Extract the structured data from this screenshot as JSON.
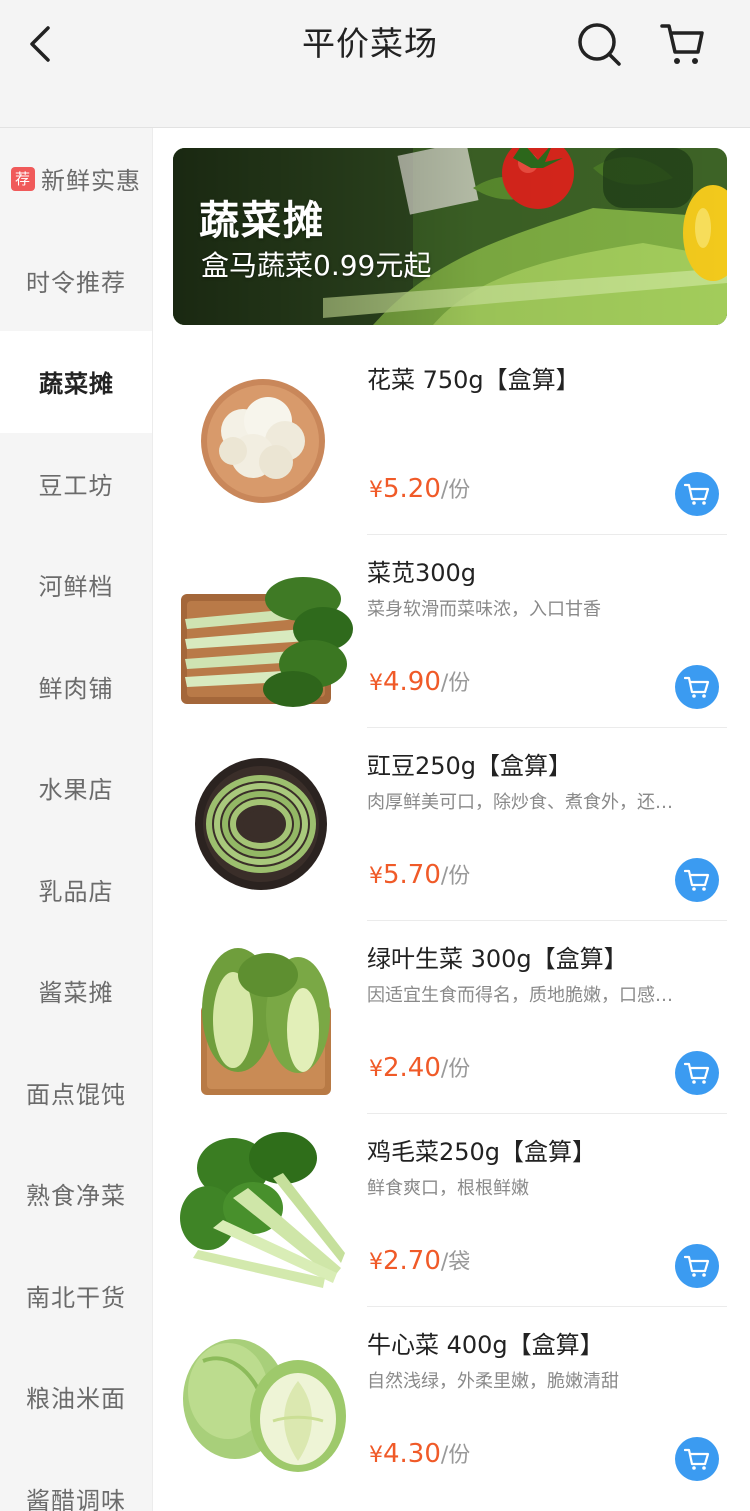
{
  "header": {
    "title": "平价菜场",
    "back_icon": "chevron-left-icon",
    "search_icon": "search-icon",
    "cart_icon": "cart-icon"
  },
  "sidebar": {
    "items": [
      {
        "label": "新鲜实惠",
        "badge": "荐"
      },
      {
        "label": "时令推荐"
      },
      {
        "label": "蔬菜摊",
        "active": true
      },
      {
        "label": "豆工坊"
      },
      {
        "label": "河鲜档"
      },
      {
        "label": "鲜肉铺"
      },
      {
        "label": "水果店"
      },
      {
        "label": "乳品店"
      },
      {
        "label": "酱菜摊"
      },
      {
        "label": "面点馄饨"
      },
      {
        "label": "熟食净菜"
      },
      {
        "label": "南北干货"
      },
      {
        "label": "粮油米面"
      },
      {
        "label": "酱醋调味"
      }
    ]
  },
  "banner": {
    "title": "蔬菜摊",
    "subtitle": "盒马蔬菜0.99元起"
  },
  "products": [
    {
      "name": "花菜 750g【盒算】",
      "desc": "",
      "currency": "¥",
      "price": "5.20",
      "unit": "/份"
    },
    {
      "name": "菜苋300g",
      "desc": "菜身软滑而菜味浓，入口甘香",
      "currency": "¥",
      "price": "4.90",
      "unit": "/份"
    },
    {
      "name": "豇豆250g【盒算】",
      "desc": "肉厚鲜美可口，除炒食、煮食外，还…",
      "currency": "¥",
      "price": "5.70",
      "unit": "/份"
    },
    {
      "name": "绿叶生菜 300g【盒算】",
      "desc": "因适宜生食而得名，质地脆嫩，口感…",
      "currency": "¥",
      "price": "2.40",
      "unit": "/份"
    },
    {
      "name": "鸡毛菜250g【盒算】",
      "desc": "鲜食爽口，根根鲜嫩",
      "currency": "¥",
      "price": "2.70",
      "unit": "/袋"
    },
    {
      "name": "牛心菜 400g【盒算】",
      "desc": "自然浅绿，外柔里嫩，脆嫩清甜",
      "currency": "¥",
      "price": "4.30",
      "unit": "/份"
    }
  ],
  "colors": {
    "price": "#f05a28",
    "accent_button": "#3b9bf1",
    "badge": "#f05a5a",
    "sidebar_bg": "#f5f5f5",
    "header_bg": "#f4f4f4"
  }
}
